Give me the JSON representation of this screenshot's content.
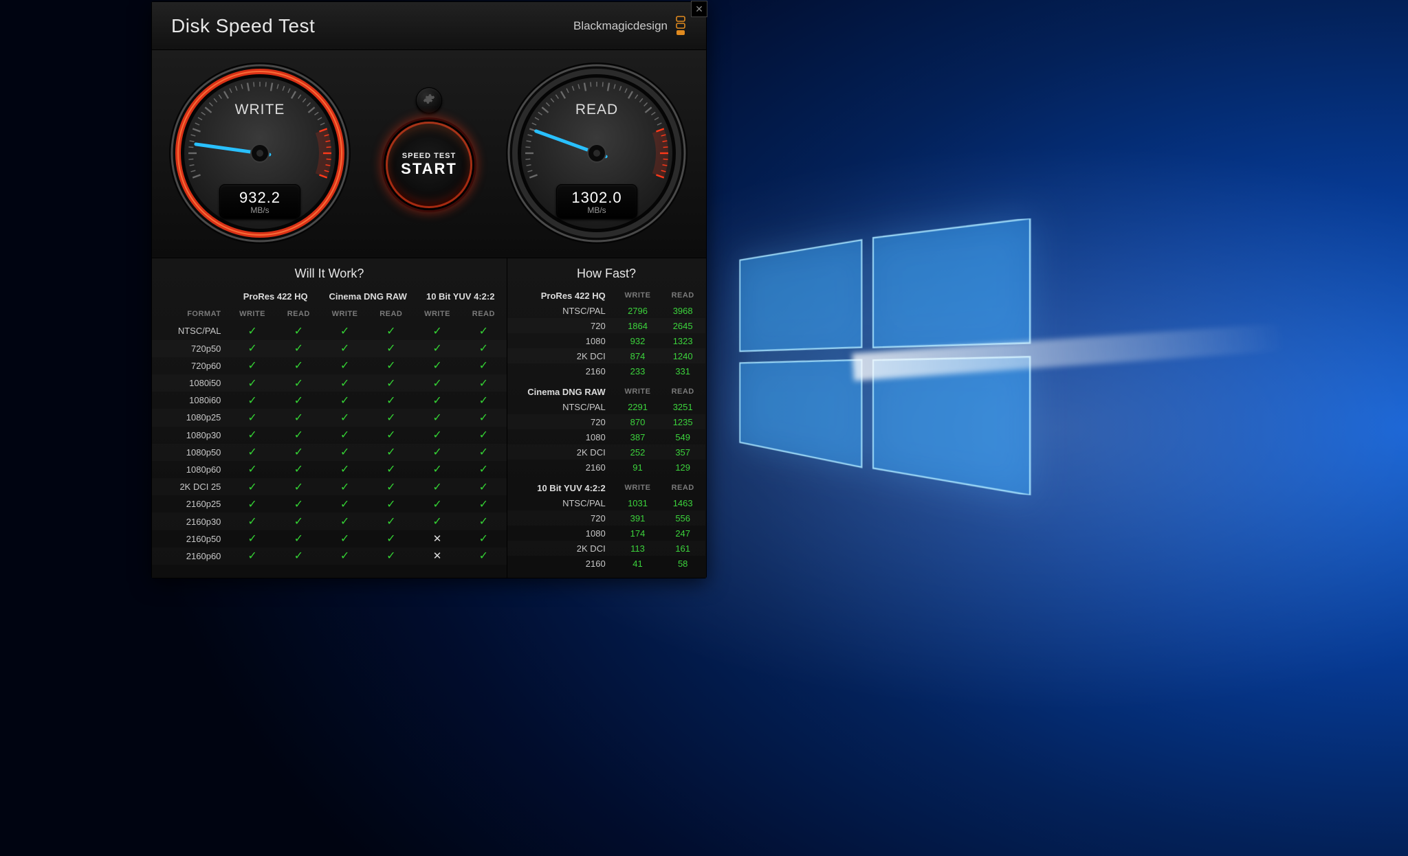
{
  "app_title": "Disk Speed Test",
  "brand": "Blackmagicdesign",
  "start_button": {
    "line1": "SPEED TEST",
    "line2": "START"
  },
  "gauges": {
    "write": {
      "label": "WRITE",
      "value": "932.2",
      "unit": "MB/s",
      "needle_angle": -172
    },
    "read": {
      "label": "READ",
      "value": "1302.0",
      "unit": "MB/s",
      "needle_angle": -160
    }
  },
  "accent_red": "#ff3a1a",
  "accent_green": "#34d234",
  "will_it_work": {
    "title": "Will It Work?",
    "format_header": "FORMAT",
    "col_sub": {
      "write": "WRITE",
      "read": "READ"
    },
    "groups": [
      "ProRes 422 HQ",
      "Cinema DNG RAW",
      "10 Bit YUV 4:2:2"
    ],
    "rows": [
      {
        "fmt": "NTSC/PAL",
        "cells": [
          "y",
          "y",
          "y",
          "y",
          "y",
          "y"
        ]
      },
      {
        "fmt": "720p50",
        "cells": [
          "y",
          "y",
          "y",
          "y",
          "y",
          "y"
        ]
      },
      {
        "fmt": "720p60",
        "cells": [
          "y",
          "y",
          "y",
          "y",
          "y",
          "y"
        ]
      },
      {
        "fmt": "1080i50",
        "cells": [
          "y",
          "y",
          "y",
          "y",
          "y",
          "y"
        ]
      },
      {
        "fmt": "1080i60",
        "cells": [
          "y",
          "y",
          "y",
          "y",
          "y",
          "y"
        ]
      },
      {
        "fmt": "1080p25",
        "cells": [
          "y",
          "y",
          "y",
          "y",
          "y",
          "y"
        ]
      },
      {
        "fmt": "1080p30",
        "cells": [
          "y",
          "y",
          "y",
          "y",
          "y",
          "y"
        ]
      },
      {
        "fmt": "1080p50",
        "cells": [
          "y",
          "y",
          "y",
          "y",
          "y",
          "y"
        ]
      },
      {
        "fmt": "1080p60",
        "cells": [
          "y",
          "y",
          "y",
          "y",
          "y",
          "y"
        ]
      },
      {
        "fmt": "2K DCI 25",
        "cells": [
          "y",
          "y",
          "y",
          "y",
          "y",
          "y"
        ]
      },
      {
        "fmt": "2160p25",
        "cells": [
          "y",
          "y",
          "y",
          "y",
          "y",
          "y"
        ]
      },
      {
        "fmt": "2160p30",
        "cells": [
          "y",
          "y",
          "y",
          "y",
          "y",
          "y"
        ]
      },
      {
        "fmt": "2160p50",
        "cells": [
          "y",
          "y",
          "y",
          "y",
          "n",
          "y"
        ]
      },
      {
        "fmt": "2160p60",
        "cells": [
          "y",
          "y",
          "y",
          "y",
          "n",
          "y"
        ]
      }
    ]
  },
  "how_fast": {
    "title": "How Fast?",
    "col_sub": {
      "write": "WRITE",
      "read": "READ"
    },
    "groups": [
      {
        "name": "ProRes 422 HQ",
        "rows": [
          {
            "fmt": "NTSC/PAL",
            "write": "2796",
            "read": "3968"
          },
          {
            "fmt": "720",
            "write": "1864",
            "read": "2645"
          },
          {
            "fmt": "1080",
            "write": "932",
            "read": "1323"
          },
          {
            "fmt": "2K DCI",
            "write": "874",
            "read": "1240"
          },
          {
            "fmt": "2160",
            "write": "233",
            "read": "331"
          }
        ]
      },
      {
        "name": "Cinema DNG RAW",
        "rows": [
          {
            "fmt": "NTSC/PAL",
            "write": "2291",
            "read": "3251"
          },
          {
            "fmt": "720",
            "write": "870",
            "read": "1235"
          },
          {
            "fmt": "1080",
            "write": "387",
            "read": "549"
          },
          {
            "fmt": "2K DCI",
            "write": "252",
            "read": "357"
          },
          {
            "fmt": "2160",
            "write": "91",
            "read": "129"
          }
        ]
      },
      {
        "name": "10 Bit YUV 4:2:2",
        "rows": [
          {
            "fmt": "NTSC/PAL",
            "write": "1031",
            "read": "1463"
          },
          {
            "fmt": "720",
            "write": "391",
            "read": "556"
          },
          {
            "fmt": "1080",
            "write": "174",
            "read": "247"
          },
          {
            "fmt": "2K DCI",
            "write": "113",
            "read": "161"
          },
          {
            "fmt": "2160",
            "write": "41",
            "read": "58"
          }
        ]
      }
    ]
  }
}
